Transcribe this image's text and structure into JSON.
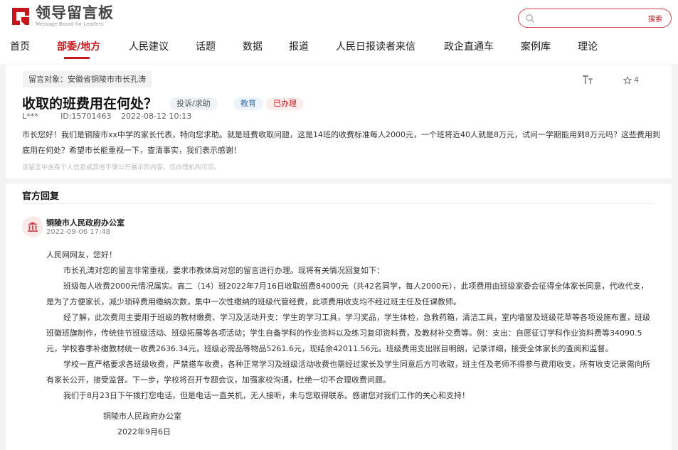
{
  "header": {
    "logo_cn": "领导留言板",
    "logo_en": "Message Board for Leaders",
    "search_placeholder": "",
    "search_button": "搜索",
    "colors": {
      "brand": "#c8161d"
    }
  },
  "nav": {
    "items": [
      {
        "label": "首页",
        "active": false
      },
      {
        "label": "部委/地方",
        "active": true
      },
      {
        "label": "人民建议",
        "active": false
      },
      {
        "label": "话题",
        "active": false
      },
      {
        "label": "数据",
        "active": false
      },
      {
        "label": "报道",
        "active": false
      },
      {
        "label": "人民日报读者来信",
        "active": false
      },
      {
        "label": "政企直通车",
        "active": false
      },
      {
        "label": "案例库",
        "active": false
      },
      {
        "label": "理论",
        "active": false
      }
    ]
  },
  "message": {
    "target": "留言对象：安徽省铜陵市市长孔涛",
    "tool_icon": "text-size-icon",
    "star_count": "4",
    "title": "收取的班费用在何处？",
    "badges": {
      "type": "投诉/求助",
      "field": "教育",
      "status": "已办理"
    },
    "author": "L***",
    "id_text": "ID:15701463",
    "datetime": "2022-08-12 10:13",
    "body": "市长您好！我们是铜陵市xx中学的家长代表，特向您求助。就是班费收取问题，这是14班的收费标准每人2000元，一个班将近40人就是8万元，试问一学期能用到8万元吗？这些费用到底用在何处？希望市长能重视一下，查清事实，我们表示感谢！",
    "note": "该留言中含有个人信息或其他不便公开展示的内容，仅办理机构可见。"
  },
  "reply": {
    "heading": "官方回复",
    "org_name": "铜陵市人民政府办公室",
    "date": "2022-09-06 17:48",
    "greeting": "人民网网友，您好！",
    "paragraphs": [
      "市长孔涛对您的留言非常重视，要求市教体局对您的留言进行办理。现将有关情况回复如下：",
      "班级每人收费2000元情况属实。高二（14）班2022年7月16日收取班费84000元（共42名同学，每人2000元），此项费用由班级家委会征得全体家长同意，代收代支，是为了方便家长，减少琐碎费用缴纳次数，集中一次性缴纳的班级代管经费，此项费用收支均不经过班主任及任课教师。",
      "经了解，此次费用主要用于班级的教材缴费、学习及活动开支：学生的学习工具，学习奖品，学生体检，急救药箱，清洁工具，室内墙窗及班级花草等各项设施布置，班级班徽班旗制作，传统佳节班级活动、班级拓展等各项活动；学生自备学科的作业资料以及练习复印资料费，及教材补交费等。例：支出：自愿征订学科作业资料费等34090.5元，学校春季补缴教材统一收费2636.34元，班级必需品等物品5261.6元，现结余42011.56元。班级费用支出账目明朗，记录详细，接受全体家长的查阅和监督。",
      "学校一直严格要求各班级收费，严禁搭车收费，各种正常学习及班级活动收费也需经过家长及学生同意后方可收取，班主任及老师不得参与费用收支，所有收支记录需向所有家长公开，接受监督。下一步，学校将召开专题会议，加强家校沟通，杜绝一切不合理收费问题。",
      "我们于8月23日下午拨打您电话，但是电话一直关机，无人接听，未与您取得联系。感谢您对我们工作的关心和支持！"
    ],
    "signature": "铜陵市人民政府办公室",
    "sign_date": "2022年9月6日"
  }
}
